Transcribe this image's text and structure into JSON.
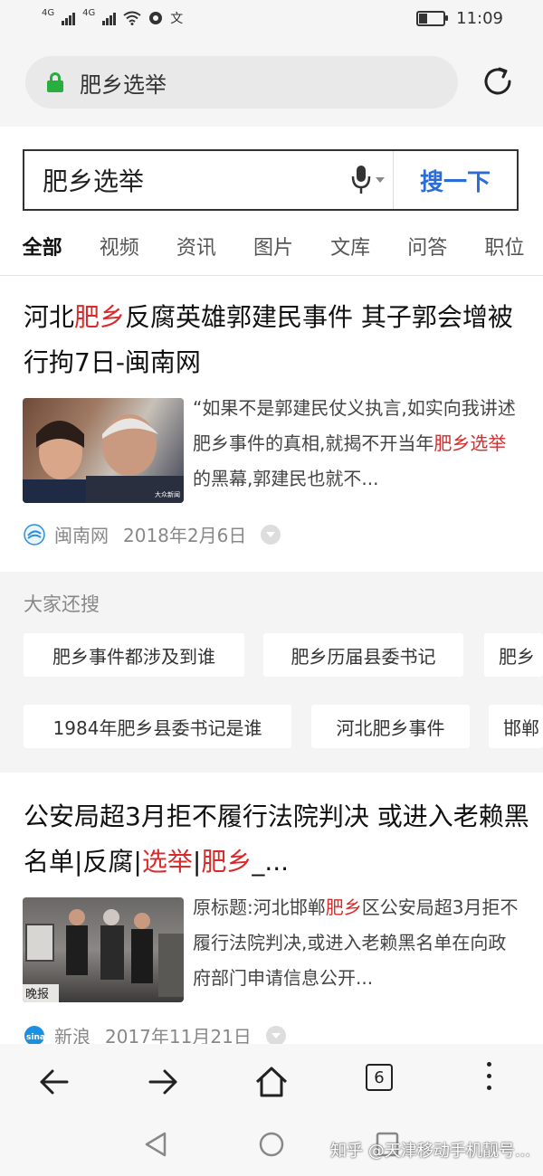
{
  "status_bar": {
    "signal1_label": "4G",
    "signal2_label": "4G",
    "extra_icon": "文",
    "time": "11:09",
    "battery_level": 0.3
  },
  "address_bar": {
    "text": "肥乡选举"
  },
  "search": {
    "query": "肥乡选举",
    "button_label": "搜一下"
  },
  "tabs": [
    {
      "label": "全部",
      "active": true
    },
    {
      "label": "视频"
    },
    {
      "label": "资讯"
    },
    {
      "label": "图片"
    },
    {
      "label": "文库"
    },
    {
      "label": "问答"
    },
    {
      "label": "职位"
    }
  ],
  "results": [
    {
      "title_parts": [
        "河北",
        "肥乡",
        "反腐英雄郭建民事件 其子郭会增被行拘7日-闽南网"
      ],
      "snippet_parts": [
        "“如果不是郭建民仗义执言,如实向我讲述肥乡事件的真相,就揭不开当年",
        "肥乡选举",
        "的黑幕,郭建民也就不..."
      ],
      "source": "闽南网",
      "date": "2018年2月6日",
      "thumb_caption": "大众新闻",
      "icon_color": "#2a8fd8"
    },
    {
      "title_parts": [
        "公安局超3月拒不履行法院判决 或进入老赖黑名单|反腐|",
        "选举",
        "|",
        "肥乡",
        "_..."
      ],
      "snippet_parts": [
        "原标题:河北邯郸",
        "肥乡",
        "区公安局超3月拒不履行法院判决,或进入老赖黑名单在向政府部门申请信息公开..."
      ],
      "source": "新浪",
      "date": "2017年11月21日",
      "thumb_caption": "晚报",
      "icon_color": "#1b8fe0"
    }
  ],
  "related": {
    "heading": "大家还搜",
    "chips": [
      "肥乡事件都涉及到谁",
      "肥乡历届县委书记",
      "肥乡",
      "1984年肥乡县委书记是谁",
      "河北肥乡事件",
      "邯郸"
    ]
  },
  "toolbar": {
    "tab_count": "6"
  },
  "watermark": "知乎 @天津移动手机靓号..."
}
